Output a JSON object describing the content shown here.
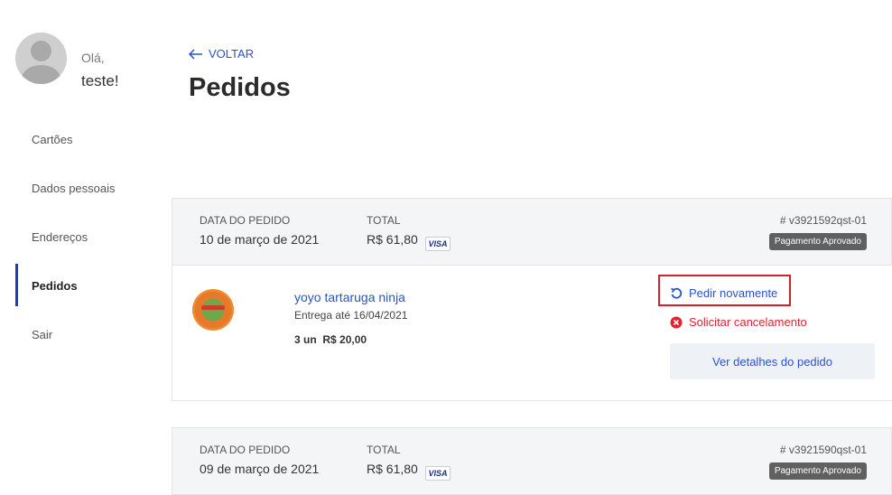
{
  "user": {
    "greeting": "Olá,",
    "name": "teste!"
  },
  "sidebar": {
    "items": [
      {
        "label": "Cartões"
      },
      {
        "label": "Dados pessoais"
      },
      {
        "label": "Endereços"
      },
      {
        "label": "Pedidos",
        "active": true
      },
      {
        "label": "Sair"
      }
    ]
  },
  "header": {
    "back_label": "VOLTAR",
    "title": "Pedidos"
  },
  "orders": [
    {
      "date_label": "DATA DO PEDIDO",
      "date": "10 de março de 2021",
      "total_label": "TOTAL",
      "total": "R$ 61,80",
      "card_brand": "VISA",
      "number": "# v3921592qst-01",
      "status": "Pagamento Aprovado",
      "item": {
        "name": "yoyo tartaruga ninja",
        "delivery": "Entrega até 16/04/2021",
        "quantity": "3 un",
        "price": "R$ 20,00"
      },
      "actions": {
        "reorder": "Pedir novamente",
        "cancel": "Solicitar cancelamento",
        "details": "Ver detalhes do pedido"
      }
    },
    {
      "date_label": "DATA DO PEDIDO",
      "date": "09 de março de 2021",
      "total_label": "TOTAL",
      "total": "R$ 61,80",
      "card_brand": "VISA",
      "number": "# v3921590qst-01",
      "status": "Pagamento Aprovado"
    }
  ],
  "colors": {
    "accent": "#2953c9",
    "danger": "#e0242e",
    "highlight_box": "#d4202a",
    "badge": "#606060"
  }
}
